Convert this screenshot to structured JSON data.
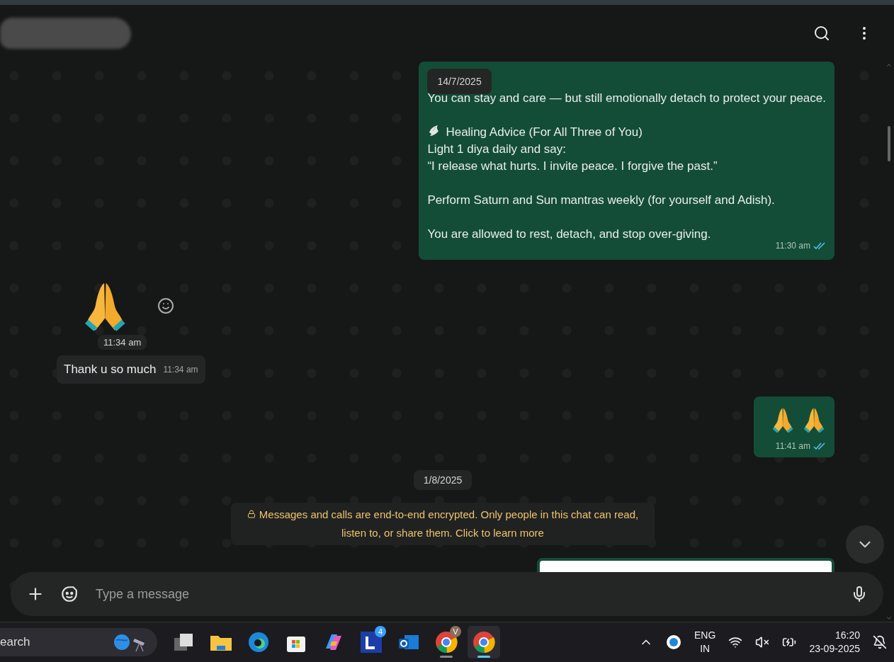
{
  "chat": {
    "messages": [
      {
        "kind": "outgoing_text",
        "date_chip": "14/7/2025",
        "paragraphs": [
          {
            "text": "You can stay and care — but still emotionally detach to protect your peace.",
            "lead_icon": false
          },
          {
            "text": "Healing Advice (For All Three of You)\nLight 1 diya daily and say:\n“I release what hurts. I invite peace. I forgive the past.”",
            "lead_icon": true
          },
          {
            "text": "Perform Saturn and Sun mantras weekly (for yourself and Adish).",
            "lead_icon": false
          },
          {
            "text": "You are allowed to rest, detach, and stop over-giving.",
            "lead_icon": false
          }
        ],
        "time": "11:30 am",
        "read": true
      },
      {
        "kind": "incoming_emoji",
        "emojis": [
          {
            "kind": "praying_hands"
          }
        ],
        "time": "11:34 am"
      },
      {
        "kind": "incoming_text",
        "text": "Thank u so much",
        "time": "11:34 am"
      },
      {
        "kind": "outgoing_emoji",
        "emojis": [
          {
            "kind": "praying_hands"
          },
          {
            "kind": "praying_hands"
          }
        ],
        "time": "11:41 am",
        "read": true
      },
      {
        "kind": "date_chip",
        "text": "1/8/2025"
      },
      {
        "kind": "system_notice",
        "text": "Messages and calls are end-to-end encrypted. Only people in this chat can read, listen to, or share them. Click to learn more"
      },
      {
        "kind": "outgoing_preview"
      }
    ]
  },
  "composer": {
    "placeholder": "Type a message"
  },
  "taskbar": {
    "search": {
      "value": "earch"
    },
    "apps": [
      {
        "kind": "taskview",
        "active": false
      },
      {
        "kind": "folder",
        "active": false
      },
      {
        "kind": "edge",
        "active": false
      },
      {
        "kind": "store",
        "active": false
      },
      {
        "kind": "copilot",
        "active": false
      },
      {
        "kind": "tile",
        "badge": "4",
        "active": false
      },
      {
        "kind": "outlook",
        "active": false
      },
      {
        "kind": "chrome",
        "badge": "V",
        "active": false
      },
      {
        "kind": "chrome",
        "active": true
      }
    ],
    "language": "ENG",
    "region": "IN",
    "time": "16:20",
    "date": "23-09-2025"
  }
}
